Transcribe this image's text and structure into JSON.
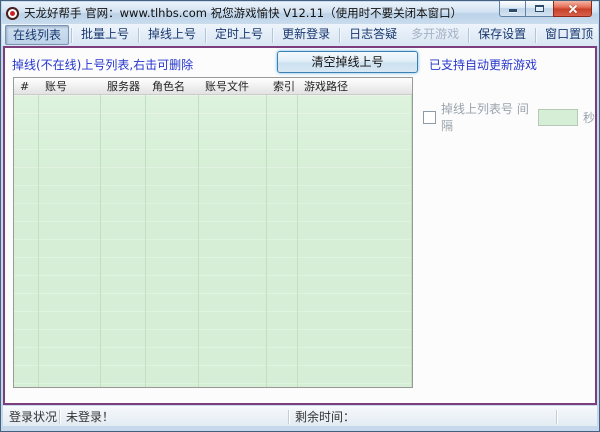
{
  "window": {
    "title": "天龙好帮手 官网：www.tlhbs.com 祝您游戏愉快 V12.11（使用时不要关闭本窗口）"
  },
  "toolbar": {
    "tabs": [
      "在线列表",
      "批量上号",
      "掉线上号",
      "定时上号",
      "更新登录",
      "日志答疑"
    ],
    "multi_open": "多开游戏",
    "save_settings": "保存设置",
    "window_top": "窗口置顶"
  },
  "content": {
    "list_hint": "掉线(不在线)上号列表,右击可删除",
    "clear_button": "清空掉线上号",
    "auto_update_notice": "已支持自动更新游戏",
    "table": {
      "columns": [
        "#",
        "账号",
        "服务器",
        "角色名",
        "账号文件",
        "索引",
        "游戏路径"
      ],
      "rows": []
    },
    "interval": {
      "checked": false,
      "label": "掉线上列表号 间隔",
      "value": "",
      "unit": "秒"
    }
  },
  "statusbar": {
    "login_label": "登录状况：",
    "login_status": "未登录！",
    "remaining_label": "剩余时间："
  },
  "colors": {
    "frame_purple": "#7c3e7c",
    "link_blue": "#2636cd",
    "table_green": "#d5eed5",
    "tab_text_navy": "#17376e",
    "close_red": "#c74129"
  }
}
